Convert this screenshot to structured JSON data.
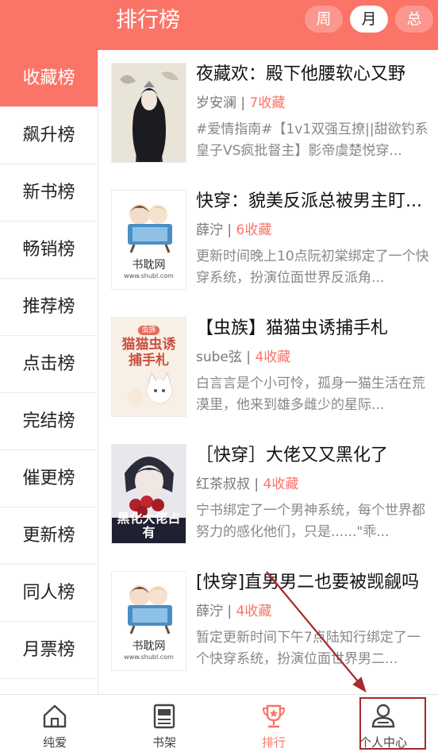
{
  "header": {
    "title": "排行榜",
    "periods": [
      "周",
      "月",
      "总"
    ],
    "active_period": "月"
  },
  "sidebar": {
    "items": [
      "收藏榜",
      "飙升榜",
      "新书榜",
      "畅销榜",
      "推荐榜",
      "点击榜",
      "完结榜",
      "催更榜",
      "更新榜",
      "同人榜",
      "月票榜"
    ],
    "active": "收藏榜"
  },
  "books": [
    {
      "title": "夜藏欢：殿下他腰软心又野",
      "author": "岁安澜",
      "favorites": "7收藏",
      "desc": "#爱情指南#【1v1双强互撩||甜欲钓系皇子VS疯批督主】影帝虞楚悦穿..."
    },
    {
      "title": "快穿：貌美反派总被男主盯...",
      "author": "薛泞",
      "favorites": "6收藏",
      "desc": "更新时间晚上10点阮初棠绑定了一个快穿系统，扮演位面世界反派角..."
    },
    {
      "title": "【虫族】猫猫虫诱捕手札",
      "author": "sube弦",
      "favorites": "4收藏",
      "desc": "白言言是个小可怜，孤身一猫生活在荒漠里，他来到雄多雌少的星际..."
    },
    {
      "title": "［快穿］大佬又又黑化了",
      "author": "红茶叔叔",
      "favorites": "4收藏",
      "desc": "宁书绑定了一个男神系统，每个世界都努力的感化他们，只是......\"乖..."
    },
    {
      "title": "[快穿]直男男二也要被觊觎吗",
      "author": "薛泞",
      "favorites": "4收藏",
      "desc": "暂定更新时间下午7点陆知行绑定了一个快穿系统，扮演位面世界男二..."
    }
  ],
  "covers": {
    "placeholder_text": "书耽网",
    "placeholder_url": "www.shubl.com",
    "cover3_text": "猫猫虫诱捕手札",
    "cover3_badge": "虫族",
    "cover4_text": "黑化大佬占有"
  },
  "bottom_nav": {
    "tabs": [
      "纯爱",
      "书架",
      "排行",
      "个人中心"
    ],
    "active": "排行"
  },
  "colors": {
    "accent": "#fa7468",
    "highlight_box": "#a52a2a"
  }
}
